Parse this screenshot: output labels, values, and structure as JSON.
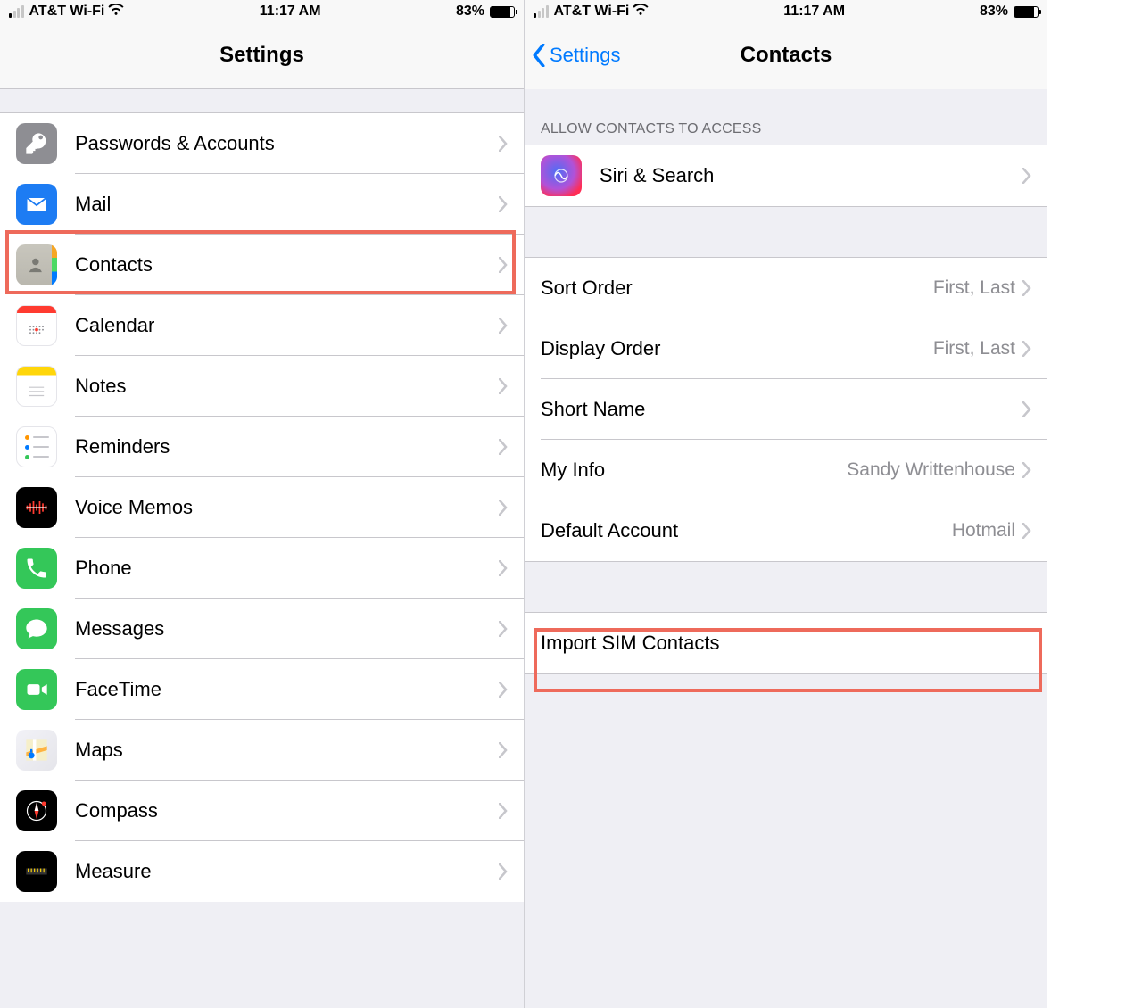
{
  "statusbar": {
    "carrier": "AT&T Wi-Fi",
    "time": "11:17 AM",
    "battery_percent": "83%",
    "battery_fill_pct": 83
  },
  "left": {
    "title": "Settings",
    "items": [
      {
        "key": "passwords",
        "label": "Passwords & Accounts"
      },
      {
        "key": "mail",
        "label": "Mail"
      },
      {
        "key": "contacts",
        "label": "Contacts",
        "highlighted": true
      },
      {
        "key": "calendar",
        "label": "Calendar"
      },
      {
        "key": "notes",
        "label": "Notes"
      },
      {
        "key": "reminders",
        "label": "Reminders"
      },
      {
        "key": "voicememos",
        "label": "Voice Memos"
      },
      {
        "key": "phone",
        "label": "Phone"
      },
      {
        "key": "messages",
        "label": "Messages"
      },
      {
        "key": "facetime",
        "label": "FaceTime"
      },
      {
        "key": "maps",
        "label": "Maps"
      },
      {
        "key": "compass",
        "label": "Compass"
      },
      {
        "key": "measure",
        "label": "Measure"
      }
    ]
  },
  "right": {
    "back_label": "Settings",
    "title": "Contacts",
    "section1_header": "ALLOW CONTACTS TO ACCESS",
    "siri_label": "Siri & Search",
    "rows": {
      "sort_order": {
        "label": "Sort Order",
        "value": "First, Last"
      },
      "display_order": {
        "label": "Display Order",
        "value": "First, Last"
      },
      "short_name": {
        "label": "Short Name",
        "value": ""
      },
      "my_info": {
        "label": "My Info",
        "value": "Sandy Writtenhouse"
      },
      "default_account": {
        "label": "Default Account",
        "value": "Hotmail"
      }
    },
    "import_label": "Import SIM Contacts"
  }
}
